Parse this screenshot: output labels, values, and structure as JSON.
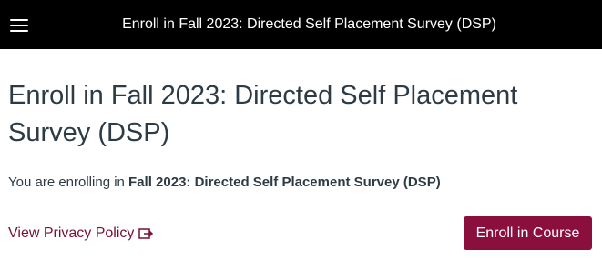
{
  "header": {
    "title": "Enroll in Fall 2023: Directed Self Placement Survey (DSP)",
    "menu_icon": "hamburger-menu-icon"
  },
  "main": {
    "page_title": "Enroll in Fall 2023: Directed Self Placement Survey (DSP)",
    "enroll_prefix": "You are enrolling in ",
    "course_name": "Fall 2023: Directed Self Placement Survey (DSP)",
    "privacy_link_label": "View Privacy Policy",
    "privacy_link_icon": "external-link-icon",
    "enroll_button_label": "Enroll in Course"
  },
  "colors": {
    "header_bg": "#000000",
    "header_text": "#ffffff",
    "body_text": "#2d3b45",
    "link": "#7a0f32",
    "button_bg": "#8a0f3d",
    "button_text": "#ffffff"
  }
}
